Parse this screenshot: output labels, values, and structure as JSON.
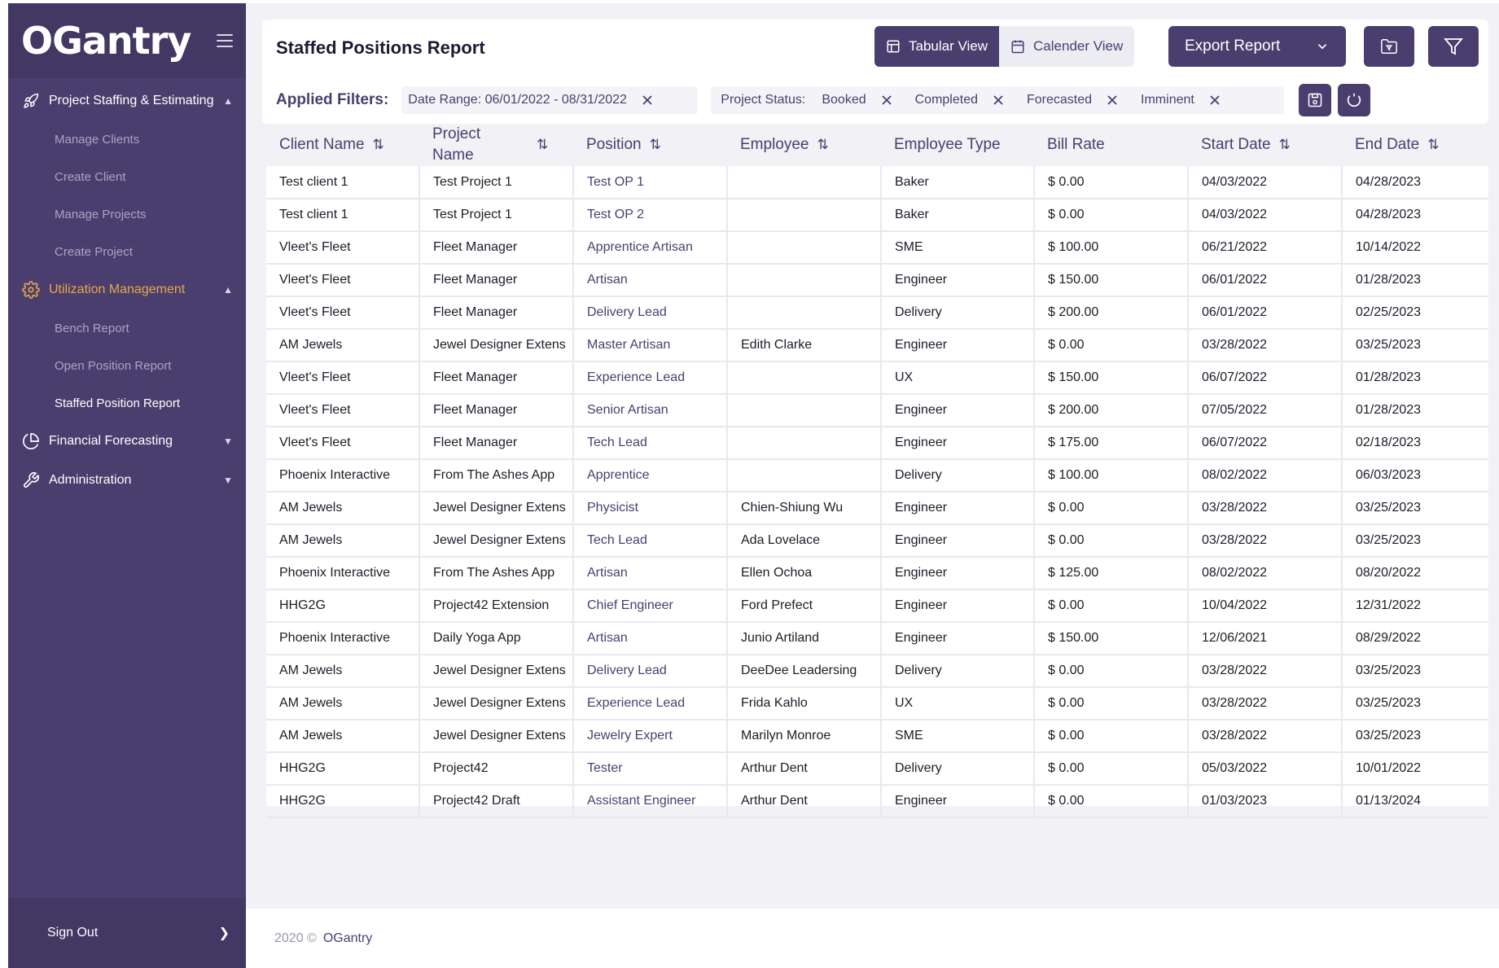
{
  "brand": {
    "name": "OGantry"
  },
  "sidebar": {
    "groups": [
      {
        "label": "Project Staffing & Estimating",
        "icon": "rocket-icon",
        "expanded": true,
        "items": [
          {
            "label": "Manage Clients"
          },
          {
            "label": "Create Client"
          },
          {
            "label": "Manage Projects"
          },
          {
            "label": "Create Project"
          }
        ]
      },
      {
        "label": "Utilization Management",
        "icon": "gear-icon",
        "expanded": true,
        "items": [
          {
            "label": "Bench Report"
          },
          {
            "label": "Open Position Report"
          },
          {
            "label": "Staffed Position Report",
            "active": true
          }
        ]
      },
      {
        "label": "Financial Forecasting",
        "icon": "pie-chart-icon",
        "expanded": false
      },
      {
        "label": "Administration",
        "icon": "wrench-icon",
        "expanded": false
      }
    ],
    "sign_out": "Sign Out"
  },
  "header": {
    "title": "Staffed Positions Report",
    "tabular_view": "Tabular View",
    "calendar_view": "Calender View",
    "export": "Export Report"
  },
  "filters": {
    "title": "Applied Filters:",
    "date_range": "Date Range: 06/01/2022 - 08/31/2022",
    "project_status_label": "Project Status:",
    "statuses": [
      "Booked",
      "Completed",
      "Forecasted",
      "Imminent"
    ]
  },
  "table": {
    "columns": [
      {
        "label": "Client Name",
        "sortable": true
      },
      {
        "label": "Project Name",
        "sortable": true
      },
      {
        "label": "Position",
        "sortable": true
      },
      {
        "label": "Employee",
        "sortable": true
      },
      {
        "label": "Employee Type",
        "sortable": false
      },
      {
        "label": "Bill Rate",
        "sortable": false
      },
      {
        "label": "Start Date",
        "sortable": true
      },
      {
        "label": "End Date",
        "sortable": true
      }
    ],
    "rows": [
      [
        "Test client 1",
        "Test Project 1",
        "Test OP 1",
        "",
        "Baker",
        "$ 0.00",
        "04/03/2022",
        "04/28/2023"
      ],
      [
        "Test client 1",
        "Test Project 1",
        "Test OP 2",
        "",
        "Baker",
        "$ 0.00",
        "04/03/2022",
        "04/28/2023"
      ],
      [
        "Vleet's Fleet",
        "Fleet Manager",
        "Apprentice Artisan",
        "",
        "SME",
        "$ 100.00",
        "06/21/2022",
        "10/14/2022"
      ],
      [
        "Vleet's Fleet",
        "Fleet Manager",
        "Artisan",
        "",
        "Engineer",
        "$ 150.00",
        "06/01/2022",
        "01/28/2023"
      ],
      [
        "Vleet's Fleet",
        "Fleet Manager",
        "Delivery Lead",
        "",
        "Delivery",
        "$ 200.00",
        "06/01/2022",
        "02/25/2023"
      ],
      [
        "AM Jewels",
        "Jewel Designer Extens",
        "Master Artisan",
        "Edith Clarke",
        "Engineer",
        "$ 0.00",
        "03/28/2022",
        "03/25/2023"
      ],
      [
        "Vleet's Fleet",
        "Fleet Manager",
        "Experience Lead",
        "",
        "UX",
        "$ 150.00",
        "06/07/2022",
        "01/28/2023"
      ],
      [
        "Vleet's Fleet",
        "Fleet Manager",
        "Senior Artisan",
        "",
        "Engineer",
        "$ 200.00",
        "07/05/2022",
        "01/28/2023"
      ],
      [
        "Vleet's Fleet",
        "Fleet Manager",
        "Tech Lead",
        "",
        "Engineer",
        "$ 175.00",
        "06/07/2022",
        "02/18/2023"
      ],
      [
        "Phoenix Interactive",
        "From The Ashes App",
        "Apprentice",
        "",
        "Delivery",
        "$ 100.00",
        "08/02/2022",
        "06/03/2023"
      ],
      [
        "AM Jewels",
        "Jewel Designer Extens",
        "Physicist",
        "Chien-Shiung Wu",
        "Engineer",
        "$ 0.00",
        "03/28/2022",
        "03/25/2023"
      ],
      [
        "AM Jewels",
        "Jewel Designer Extens",
        "Tech Lead",
        "Ada Lovelace",
        "Engineer",
        "$ 0.00",
        "03/28/2022",
        "03/25/2023"
      ],
      [
        "Phoenix Interactive",
        "From The Ashes App",
        "Artisan",
        "Ellen Ochoa",
        "Engineer",
        "$ 125.00",
        "08/02/2022",
        "08/20/2022"
      ],
      [
        "HHG2G",
        "Project42 Extension",
        "Chief Engineer",
        "Ford Prefect",
        "Engineer",
        "$ 0.00",
        "10/04/2022",
        "12/31/2022"
      ],
      [
        "Phoenix Interactive",
        "Daily Yoga App",
        "Artisan",
        "Junio Artiland",
        "Engineer",
        "$ 150.00",
        "12/06/2021",
        "08/29/2022"
      ],
      [
        "AM Jewels",
        "Jewel Designer Extens",
        "Delivery Lead",
        "DeeDee Leadersing",
        "Delivery",
        "$ 0.00",
        "03/28/2022",
        "03/25/2023"
      ],
      [
        "AM Jewels",
        "Jewel Designer Extens",
        "Experience Lead",
        "Frida Kahlo",
        "UX",
        "$ 0.00",
        "03/28/2022",
        "03/25/2023"
      ],
      [
        "AM Jewels",
        "Jewel Designer Extens",
        "Jewelry Expert",
        "Marilyn Monroe",
        "SME",
        "$ 0.00",
        "03/28/2022",
        "03/25/2023"
      ],
      [
        "HHG2G",
        "Project42",
        "Tester",
        "Arthur Dent",
        "Delivery",
        "$ 0.00",
        "05/03/2022",
        "10/01/2022"
      ],
      [
        "HHG2G",
        "Project42 Draft",
        "Assistant Engineer",
        "Arthur Dent",
        "Engineer",
        "$ 0.00",
        "01/03/2023",
        "01/13/2024"
      ]
    ]
  },
  "footer": {
    "copyright": "2020 ©",
    "brand": "OGantry"
  },
  "colors": {
    "primary": "#4a3e6e",
    "accent": "#e8a64a",
    "background": "#f1f1f6"
  }
}
